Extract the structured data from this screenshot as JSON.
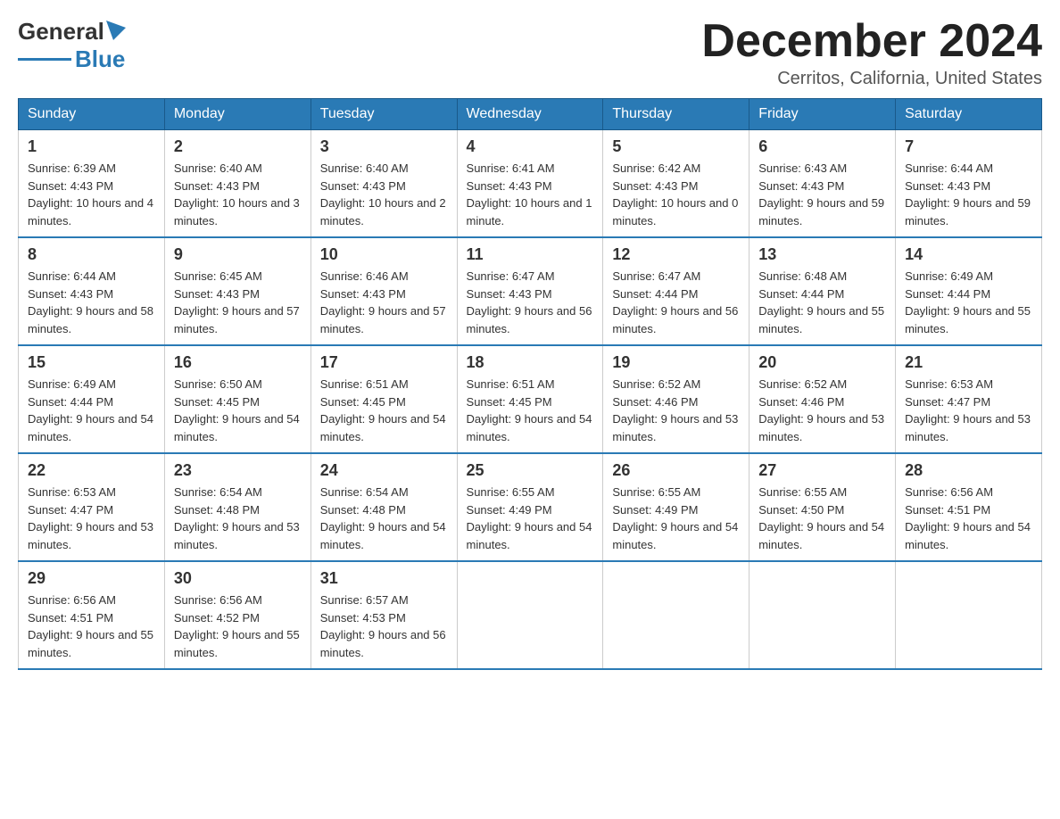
{
  "header": {
    "logo_text_black": "General",
    "logo_text_blue": "Blue",
    "month_year": "December 2024",
    "location": "Cerritos, California, United States"
  },
  "calendar": {
    "headers": [
      "Sunday",
      "Monday",
      "Tuesday",
      "Wednesday",
      "Thursday",
      "Friday",
      "Saturday"
    ],
    "weeks": [
      [
        {
          "day": "1",
          "sunrise": "6:39 AM",
          "sunset": "4:43 PM",
          "daylight": "10 hours and 4 minutes."
        },
        {
          "day": "2",
          "sunrise": "6:40 AM",
          "sunset": "4:43 PM",
          "daylight": "10 hours and 3 minutes."
        },
        {
          "day": "3",
          "sunrise": "6:40 AM",
          "sunset": "4:43 PM",
          "daylight": "10 hours and 2 minutes."
        },
        {
          "day": "4",
          "sunrise": "6:41 AM",
          "sunset": "4:43 PM",
          "daylight": "10 hours and 1 minute."
        },
        {
          "day": "5",
          "sunrise": "6:42 AM",
          "sunset": "4:43 PM",
          "daylight": "10 hours and 0 minutes."
        },
        {
          "day": "6",
          "sunrise": "6:43 AM",
          "sunset": "4:43 PM",
          "daylight": "9 hours and 59 minutes."
        },
        {
          "day": "7",
          "sunrise": "6:44 AM",
          "sunset": "4:43 PM",
          "daylight": "9 hours and 59 minutes."
        }
      ],
      [
        {
          "day": "8",
          "sunrise": "6:44 AM",
          "sunset": "4:43 PM",
          "daylight": "9 hours and 58 minutes."
        },
        {
          "day": "9",
          "sunrise": "6:45 AM",
          "sunset": "4:43 PM",
          "daylight": "9 hours and 57 minutes."
        },
        {
          "day": "10",
          "sunrise": "6:46 AM",
          "sunset": "4:43 PM",
          "daylight": "9 hours and 57 minutes."
        },
        {
          "day": "11",
          "sunrise": "6:47 AM",
          "sunset": "4:43 PM",
          "daylight": "9 hours and 56 minutes."
        },
        {
          "day": "12",
          "sunrise": "6:47 AM",
          "sunset": "4:44 PM",
          "daylight": "9 hours and 56 minutes."
        },
        {
          "day": "13",
          "sunrise": "6:48 AM",
          "sunset": "4:44 PM",
          "daylight": "9 hours and 55 minutes."
        },
        {
          "day": "14",
          "sunrise": "6:49 AM",
          "sunset": "4:44 PM",
          "daylight": "9 hours and 55 minutes."
        }
      ],
      [
        {
          "day": "15",
          "sunrise": "6:49 AM",
          "sunset": "4:44 PM",
          "daylight": "9 hours and 54 minutes."
        },
        {
          "day": "16",
          "sunrise": "6:50 AM",
          "sunset": "4:45 PM",
          "daylight": "9 hours and 54 minutes."
        },
        {
          "day": "17",
          "sunrise": "6:51 AM",
          "sunset": "4:45 PM",
          "daylight": "9 hours and 54 minutes."
        },
        {
          "day": "18",
          "sunrise": "6:51 AM",
          "sunset": "4:45 PM",
          "daylight": "9 hours and 54 minutes."
        },
        {
          "day": "19",
          "sunrise": "6:52 AM",
          "sunset": "4:46 PM",
          "daylight": "9 hours and 53 minutes."
        },
        {
          "day": "20",
          "sunrise": "6:52 AM",
          "sunset": "4:46 PM",
          "daylight": "9 hours and 53 minutes."
        },
        {
          "day": "21",
          "sunrise": "6:53 AM",
          "sunset": "4:47 PM",
          "daylight": "9 hours and 53 minutes."
        }
      ],
      [
        {
          "day": "22",
          "sunrise": "6:53 AM",
          "sunset": "4:47 PM",
          "daylight": "9 hours and 53 minutes."
        },
        {
          "day": "23",
          "sunrise": "6:54 AM",
          "sunset": "4:48 PM",
          "daylight": "9 hours and 53 minutes."
        },
        {
          "day": "24",
          "sunrise": "6:54 AM",
          "sunset": "4:48 PM",
          "daylight": "9 hours and 54 minutes."
        },
        {
          "day": "25",
          "sunrise": "6:55 AM",
          "sunset": "4:49 PM",
          "daylight": "9 hours and 54 minutes."
        },
        {
          "day": "26",
          "sunrise": "6:55 AM",
          "sunset": "4:49 PM",
          "daylight": "9 hours and 54 minutes."
        },
        {
          "day": "27",
          "sunrise": "6:55 AM",
          "sunset": "4:50 PM",
          "daylight": "9 hours and 54 minutes."
        },
        {
          "day": "28",
          "sunrise": "6:56 AM",
          "sunset": "4:51 PM",
          "daylight": "9 hours and 54 minutes."
        }
      ],
      [
        {
          "day": "29",
          "sunrise": "6:56 AM",
          "sunset": "4:51 PM",
          "daylight": "9 hours and 55 minutes."
        },
        {
          "day": "30",
          "sunrise": "6:56 AM",
          "sunset": "4:52 PM",
          "daylight": "9 hours and 55 minutes."
        },
        {
          "day": "31",
          "sunrise": "6:57 AM",
          "sunset": "4:53 PM",
          "daylight": "9 hours and 56 minutes."
        },
        null,
        null,
        null,
        null
      ]
    ]
  }
}
